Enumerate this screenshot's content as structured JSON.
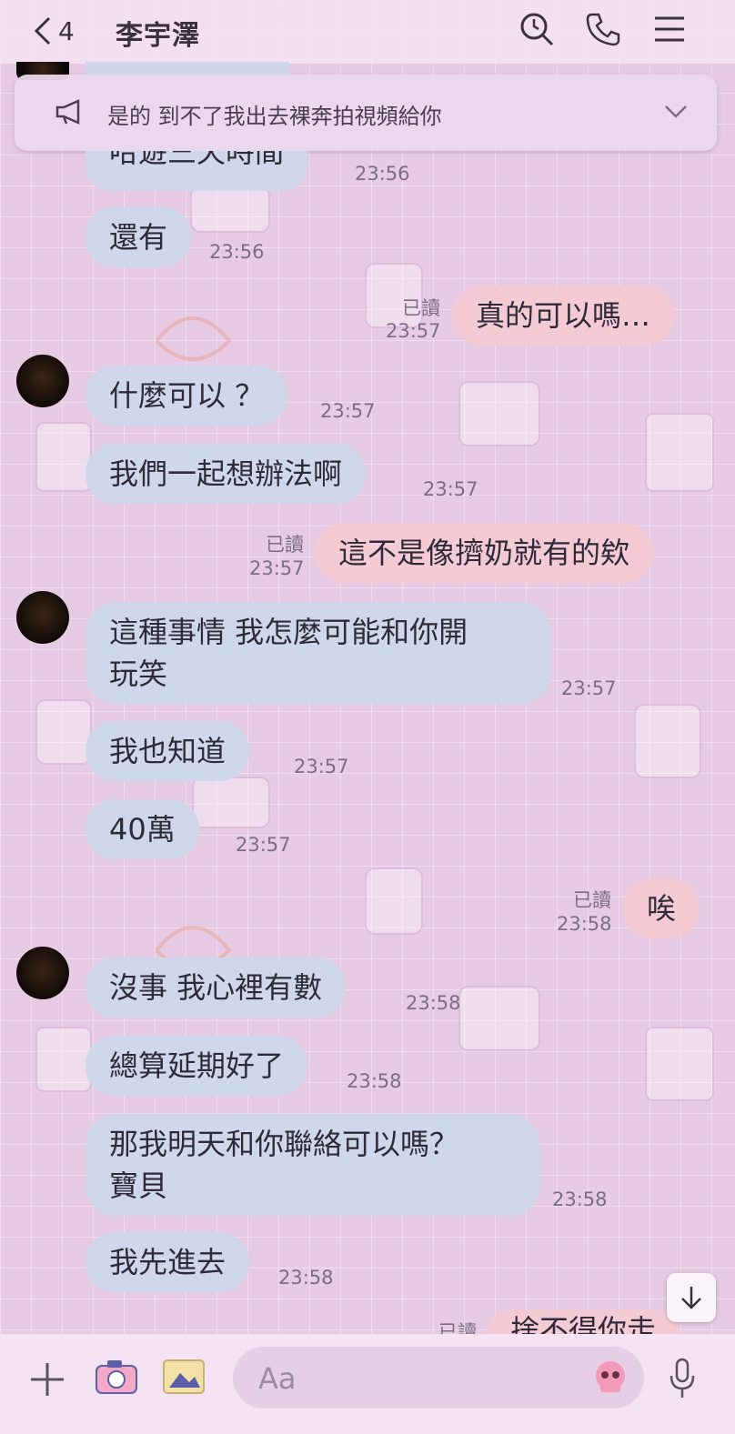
{
  "header": {
    "back_count": "4",
    "title": "李宇澤"
  },
  "announcement": {
    "text": "是的 到不了我出去裸奔拍視頻給你"
  },
  "messages": [
    {
      "text": "哈遊三天時間",
      "time": "23:56"
    },
    {
      "text": "還有",
      "time": "23:56"
    },
    {
      "text": "真的可以嗎…",
      "time": "23:57",
      "read": "已讀"
    },
    {
      "text": "什麼可以 ？",
      "time": "23:57"
    },
    {
      "text": "我們一起想辦法啊",
      "time": "23:57"
    },
    {
      "text": "這不是像擠奶就有的欸",
      "time": "23:57",
      "read": "已讀"
    },
    {
      "text_line1": "這種事情 我怎麼可能和你開",
      "text_line2": "玩笑",
      "time": "23:57"
    },
    {
      "text": "我也知道",
      "time": "23:57"
    },
    {
      "text": "40萬",
      "time": "23:57"
    },
    {
      "text": "唉",
      "time": "23:58",
      "read": "已讀"
    },
    {
      "text": "沒事  我心裡有數",
      "time": "23:58"
    },
    {
      "text": "總算延期好了",
      "time": "23:58"
    },
    {
      "text_line1": "那我明天和你聯絡可以嗎？",
      "text_line2": "寶貝",
      "time": "23:58"
    },
    {
      "text": "我先進去",
      "time": "23:58"
    },
    {
      "text": "捨不得你走",
      "read": "已讀"
    }
  ],
  "input": {
    "placeholder": "Aa"
  },
  "colors": {
    "incoming_bubble": "#cfd8ea",
    "outgoing_bubble": "#f4cbd5",
    "background": "#e7cbe5"
  },
  "icons": [
    "back-icon",
    "search-icon",
    "phone-icon",
    "menu-icon",
    "megaphone-icon",
    "chevron-down-icon",
    "plus-icon",
    "camera-icon",
    "photo-icon",
    "sticker-icon",
    "mic-icon",
    "arrow-down-icon"
  ]
}
